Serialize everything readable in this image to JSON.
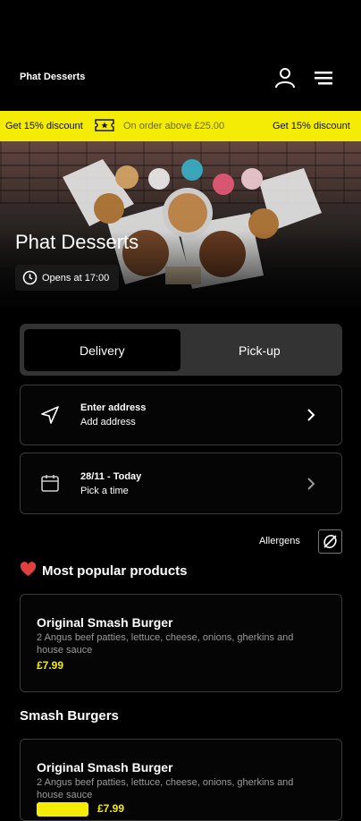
{
  "header": {
    "brand": "Phat Desserts"
  },
  "promo": {
    "left": "Get 15% discount",
    "middle": "On order above £25.00",
    "right": "Get 15% discount"
  },
  "hero": {
    "title": "Phat Desserts",
    "opens": "Opens at 17:00"
  },
  "order_mode": {
    "delivery": "Delivery",
    "pickup": "Pick-up"
  },
  "address": {
    "title": "Enter address",
    "subtitle": "Add address"
  },
  "time": {
    "title": "28/11 - Today",
    "subtitle": "Pick a time"
  },
  "allergens": {
    "label": "Allergens"
  },
  "popular": {
    "heading": "Most popular products",
    "items": [
      {
        "name": "Original Smash Burger",
        "desc": "2 Angus beef patties, lettuce, cheese, onions, gherkins and house sauce",
        "price": "£7.99"
      }
    ]
  },
  "smash": {
    "heading": "Smash Burgers",
    "items": [
      {
        "name": "Original Smash Burger",
        "desc": "2 Angus beef patties, lettuce, cheese, onions, gherkins and house sauce",
        "price": "£7.99"
      }
    ]
  },
  "colors": {
    "accent": "#f4ec05",
    "background": "#000000",
    "heart": "#e0413f"
  },
  "icons": [
    "user-icon",
    "menu-icon",
    "ticket-icon",
    "clock-icon",
    "location-arrow-icon",
    "calendar-icon",
    "chevron-right-icon",
    "allergen-icon",
    "heart-icon"
  ]
}
